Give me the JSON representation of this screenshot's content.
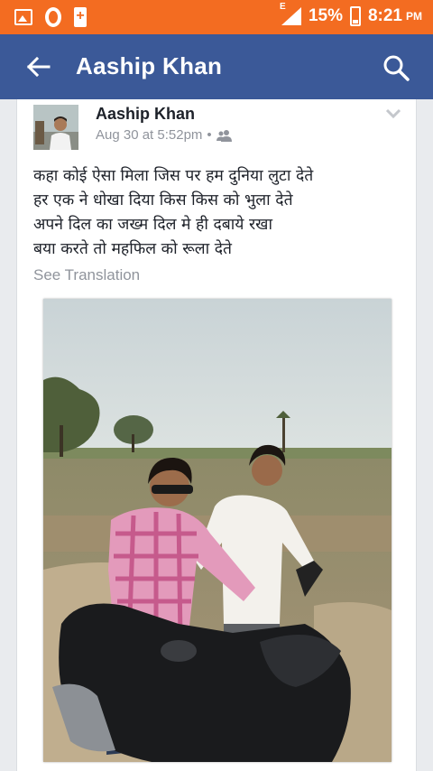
{
  "status_bar": {
    "battery_percent": "15%",
    "time": "8:21",
    "time_suffix": "PM",
    "network": "E",
    "icons": [
      "gallery-icon",
      "opera-icon",
      "battery-saver-icon",
      "signal-icon",
      "battery-icon"
    ]
  },
  "app_bar": {
    "title": "Aaship Khan",
    "back_icon": "arrow-left-icon",
    "search_icon": "search-icon",
    "color": "#3b5998"
  },
  "post": {
    "author": "Aaship Khan",
    "timestamp": "Aug 30 at 5:52pm",
    "separator": "•",
    "audience_icon": "friends-icon",
    "lines": [
      "कहा कोई ऐसा मिला जिस पर हम दुनिया लुटा देते",
      "हर एक ने धोखा दिया किस किस को भुला देते",
      "अपने दिल का जख्म दिल मे ही दबाये रखा",
      "बया करते तो महफिल को रूला देते"
    ],
    "see_translation": "See Translation"
  },
  "colors": {
    "status_bar": "#f36c21",
    "app_bar": "#3b5998",
    "background": "#e9ebee"
  }
}
